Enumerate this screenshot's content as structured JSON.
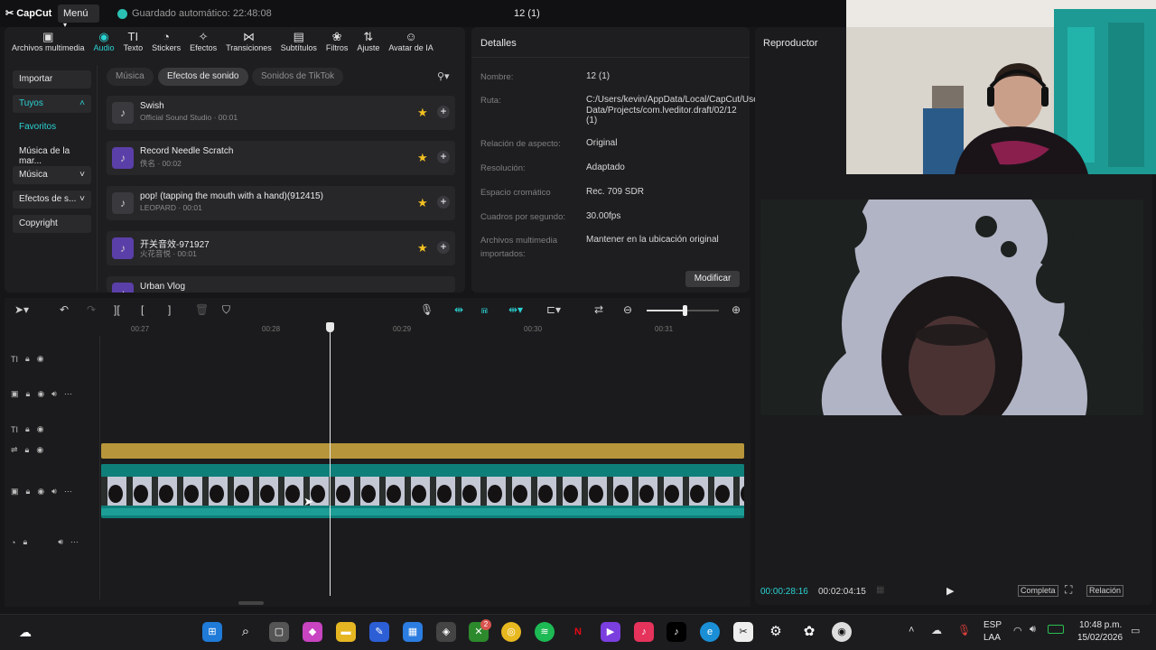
{
  "app": {
    "logo": "CapCut",
    "menu_label": "Menú",
    "autosave": "Guardado automático: 22:48:08",
    "project_title": "12 (1)"
  },
  "toolbar_tabs": [
    {
      "label": "Archivos multimedia",
      "icon": "media-icon"
    },
    {
      "label": "Audio",
      "icon": "audio-icon",
      "active": true
    },
    {
      "label": "Texto",
      "icon": "text-icon"
    },
    {
      "label": "Stickers",
      "icon": "sticker-icon"
    },
    {
      "label": "Efectos",
      "icon": "effects-icon"
    },
    {
      "label": "Transiciones",
      "icon": "transitions-icon"
    },
    {
      "label": "Subtítulos",
      "icon": "subtitles-icon"
    },
    {
      "label": "Filtros",
      "icon": "filters-icon"
    },
    {
      "label": "Ajuste",
      "icon": "adjust-icon"
    },
    {
      "label": "Avatar de IA",
      "icon": "avatar-icon"
    }
  ],
  "left_nav": {
    "importar": "Importar",
    "tuyos": "Tuyos",
    "favoritos": "Favoritos",
    "musica_marca": "Música de la mar...",
    "musica": "Música",
    "efectos": "Efectos de s...",
    "copyright": "Copyright"
  },
  "chips": {
    "musica": "Música",
    "efectos": "Efectos de sonido",
    "tiktok": "Sonidos de TikTok"
  },
  "sounds": [
    {
      "title": "Swish",
      "sub": "Official Sound Studio · 00:01"
    },
    {
      "title": "Record Needle Scratch",
      "sub": "佚名 · 00:02"
    },
    {
      "title": "pop! (tapping the mouth with a hand)(912415)",
      "sub": "LEOPARD · 00:01"
    },
    {
      "title": "开关音效-971927",
      "sub": "火花音悦 · 00:01"
    },
    {
      "title": "Urban Vlog",
      "sub": ""
    }
  ],
  "details": {
    "heading": "Detalles",
    "rows": [
      {
        "label": "Nombre:",
        "value": "12 (1)"
      },
      {
        "label": "Ruta:",
        "value": "C:/Users/kevin/AppData/Local/CapCut/User Data/Projects/com.lveditor.draft/02/12 (1)"
      },
      {
        "label": "Relación de aspecto:",
        "value": "Original"
      },
      {
        "label": "Resolución:",
        "value": "Adaptado"
      },
      {
        "label": "Espacio cromático",
        "value": "Rec. 709 SDR"
      },
      {
        "label": "Cuadros por segundo:",
        "value": "30.00fps"
      },
      {
        "label": "Archivos multimedia importados:",
        "value": "Mantener en la ubicación original"
      }
    ],
    "modify_button": "Modificar"
  },
  "player": {
    "heading": "Reproductor",
    "current_time": "00:00:28:16",
    "total_time": "00:02:04:15",
    "complete_label": "Completa",
    "ratio_label": "Relación"
  },
  "timeline": {
    "ticks": [
      "00:27",
      "00:28",
      "00:29",
      "00:30",
      "00:31"
    ]
  },
  "taskbar": {
    "lang_1": "ESP",
    "lang_2": "LAA",
    "time": "10:48 p.m.",
    "date": "15/02/2026",
    "xbox_badge": "2"
  },
  "colors": {
    "accent": "#2bd3d3",
    "adjust_clip": "#b7953a",
    "video_clip": "#0f7f7a",
    "star": "#f2c021"
  }
}
